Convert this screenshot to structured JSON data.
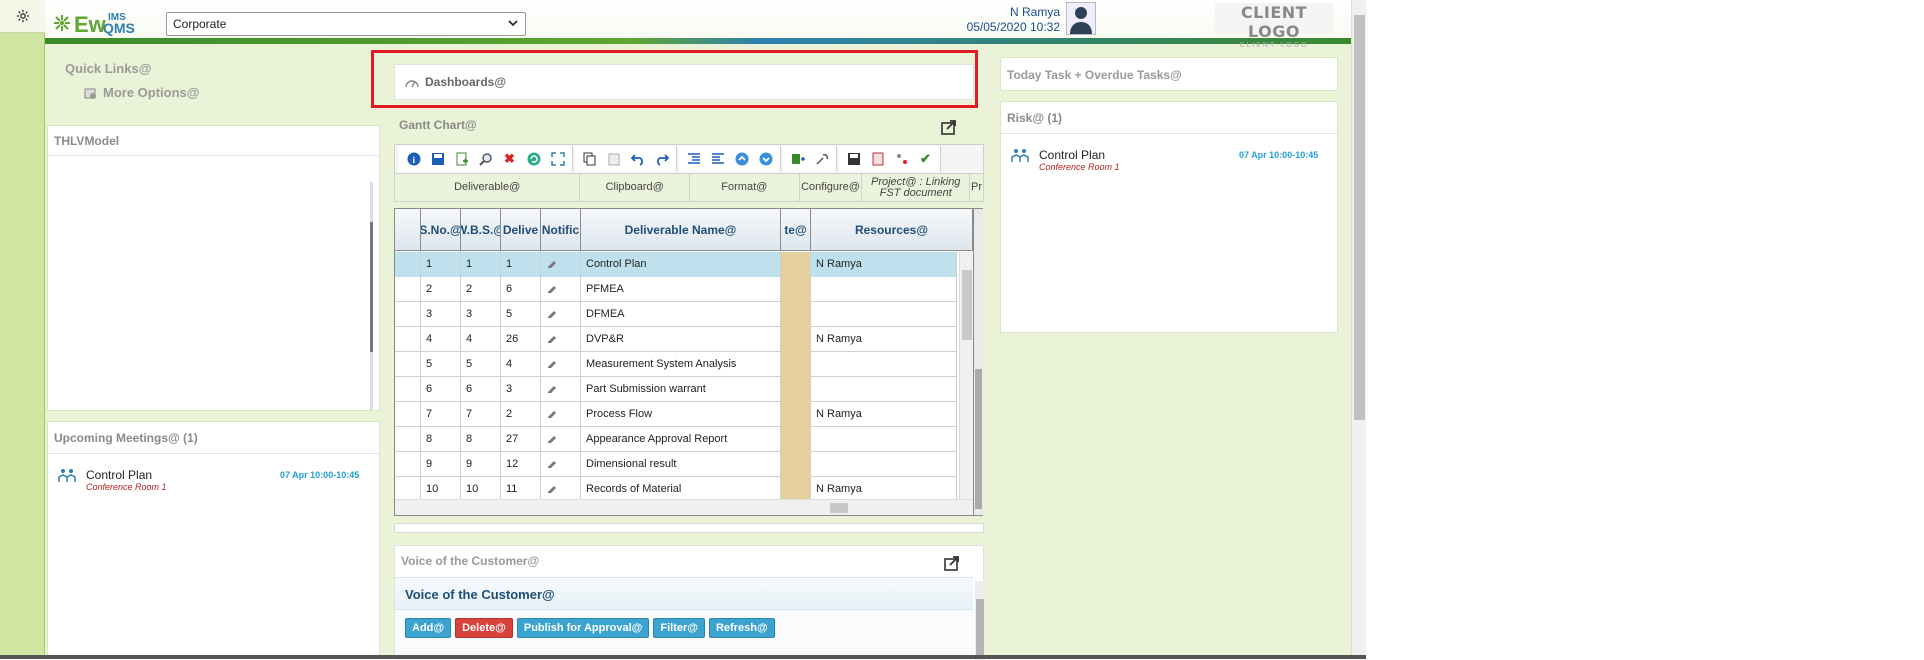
{
  "header": {
    "logo_text": "EwQMS",
    "logo_sup": "IMS",
    "company": "Corporate",
    "user_name": "N Ramya",
    "datetime": "05/05/2020 10:32",
    "client_logo": "CLIENT LOGO",
    "client_logo_sub": "CLIENT LOGO"
  },
  "quick_links": {
    "title": "Quick Links@",
    "more": "More Options@"
  },
  "thlv": {
    "title": "THLVModel"
  },
  "meetings": {
    "title": "Upcoming Meetings@ (1)",
    "items": [
      {
        "title": "Control Plan",
        "room": "Conference Room 1",
        "time": "07 Apr 10:00-10:45"
      }
    ]
  },
  "dashboard": {
    "title": "Dashboards@"
  },
  "gantt": {
    "title": "Gantt Chart@",
    "toolbar_labels": [
      "Deliverable@",
      "Clipboard@",
      "Format@",
      "Configure@",
      "Project@ : Linking FST document",
      "Pr"
    ],
    "columns": [
      "S.No.@",
      "W.B.S.@",
      "Delive",
      "Notific",
      "Deliverable Name@",
      "te@",
      "Resources@"
    ],
    "rows": [
      {
        "sno": "1",
        "wbs": "1",
        "del": "1",
        "name": "Control Plan",
        "res": "N Ramya"
      },
      {
        "sno": "2",
        "wbs": "2",
        "del": "6",
        "name": "PFMEA",
        "res": ""
      },
      {
        "sno": "3",
        "wbs": "3",
        "del": "5",
        "name": "DFMEA",
        "res": ""
      },
      {
        "sno": "4",
        "wbs": "4",
        "del": "26",
        "name": "DVP&R",
        "res": "N Ramya"
      },
      {
        "sno": "5",
        "wbs": "5",
        "del": "4",
        "name": "Measurement System Analysis",
        "res": ""
      },
      {
        "sno": "6",
        "wbs": "6",
        "del": "3",
        "name": "Part Submission warrant",
        "res": ""
      },
      {
        "sno": "7",
        "wbs": "7",
        "del": "2",
        "name": "Process Flow",
        "res": "N Ramya"
      },
      {
        "sno": "8",
        "wbs": "8",
        "del": "27",
        "name": "Appearance Approval Report",
        "res": ""
      },
      {
        "sno": "9",
        "wbs": "9",
        "del": "12",
        "name": "Dimensional result",
        "res": ""
      },
      {
        "sno": "10",
        "wbs": "10",
        "del": "11",
        "name": "Records of Material",
        "res": "N Ramya"
      }
    ]
  },
  "voc": {
    "title": "Voice of the Customer@",
    "subtitle": "Voice of the Customer@",
    "buttons": [
      "Add@",
      "Delete@",
      "Publish for Approval@",
      "Filter@",
      "Refresh@"
    ]
  },
  "today": {
    "title": "Today Task + Overdue Tasks@"
  },
  "risk": {
    "title": "Risk@ (1)",
    "items": [
      {
        "title": "Control Plan",
        "room": "Conference Room 1",
        "time": "07 Apr 10:00-10:45"
      }
    ]
  }
}
